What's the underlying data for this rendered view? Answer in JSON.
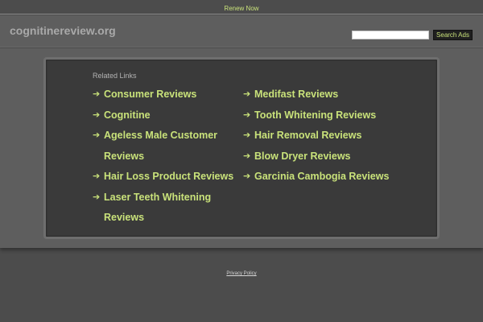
{
  "topbar": {
    "renew_label": "Renew Now"
  },
  "header": {
    "site_name": "cognitinereview.org",
    "search": {
      "value": "",
      "placeholder": ""
    },
    "search_button_label": "Search Ads"
  },
  "related": {
    "title": "Related Links",
    "left_links": [
      "Consumer Reviews",
      "Cognitine",
      "Ageless Male Customer Reviews",
      "Hair Loss Product Reviews",
      "Laser Teeth Whitening Reviews"
    ],
    "right_links": [
      "Medifast Reviews",
      "Tooth Whitening Reviews",
      "Hair Removal Reviews",
      "Blow Dryer Reviews",
      "Garcinia Cambogia Reviews"
    ],
    "arrow_glyph": "➔"
  },
  "footer": {
    "privacy_label": "Privacy Policy"
  },
  "colors": {
    "accent": "#c9e27a",
    "background": "#4c4c4c",
    "panel": "#3a3a3a"
  }
}
